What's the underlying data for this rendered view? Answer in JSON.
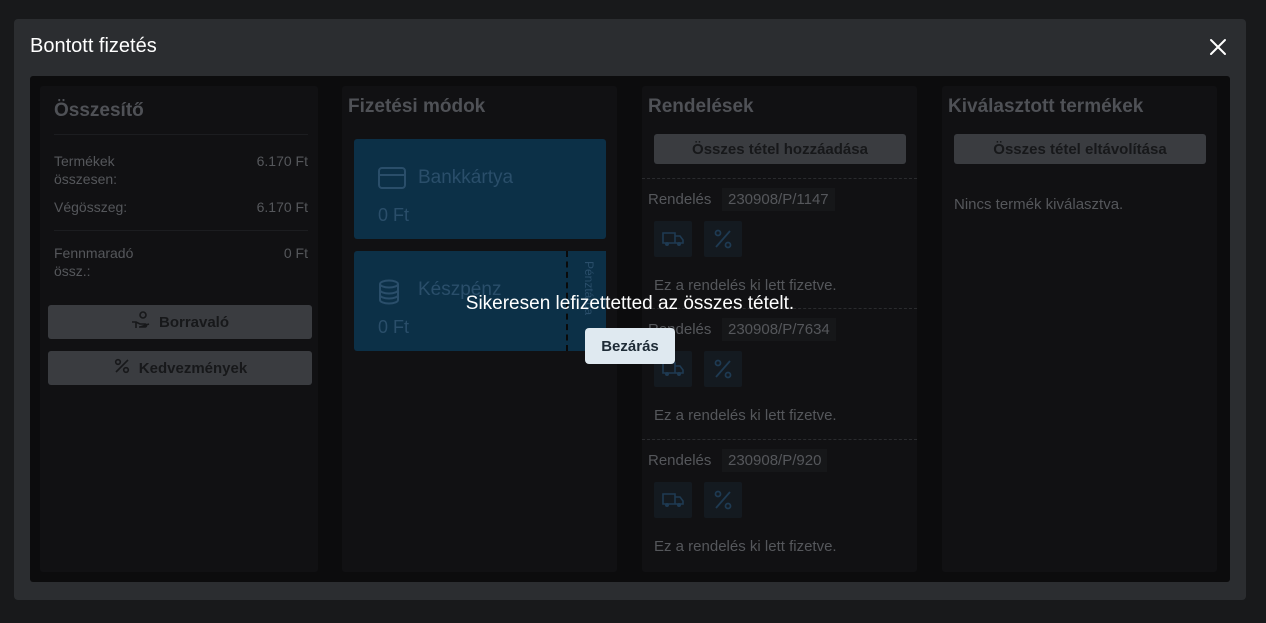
{
  "modal": {
    "title": "Bontott fizetés",
    "close_icon": "close-icon"
  },
  "summary": {
    "title": "Összesítő",
    "rows": [
      {
        "label": "Termékek összesen:",
        "value": "6.170 Ft"
      },
      {
        "label": "Végösszeg:",
        "value": "6.170 Ft"
      },
      {
        "label": "Fennmaradó össz.:",
        "value": "0 Ft"
      }
    ],
    "tip_button": "Borravaló",
    "discount_button": "Kedvezmények"
  },
  "payment": {
    "title": "Fizetési módok",
    "methods": [
      {
        "name": "Bankkártya",
        "amount": "0 Ft",
        "icon": "credit-card-icon"
      },
      {
        "name": "Készpénz",
        "amount": "0 Ft",
        "icon": "coins-icon",
        "side_label": "Pénztárca"
      }
    ]
  },
  "orders": {
    "title": "Rendelések",
    "add_all_button": "Összes tétel hozzáadása",
    "items": [
      {
        "label": "Rendelés",
        "id": "230908/P/1147",
        "status": "Ez a rendelés ki lett fizetve."
      },
      {
        "label": "Rendelés",
        "id": "230908/P/7634",
        "status": "Ez a rendelés ki lett fizetve."
      },
      {
        "label": "Rendelés",
        "id": "230908/P/920",
        "status": "Ez a rendelés ki lett fizetve."
      }
    ]
  },
  "selected": {
    "title": "Kiválasztott termékek",
    "remove_all_button": "Összes tétel eltávolítása",
    "empty_text": "Nincs termék kiválasztva."
  },
  "toast": {
    "message": "Sikeresen lefizettetted az összes tételt.",
    "close_button": "Bezárás"
  },
  "colors": {
    "modal_bg": "#2b2d30",
    "accent": "#0c3047",
    "toast_button": "#dfe9f0"
  }
}
